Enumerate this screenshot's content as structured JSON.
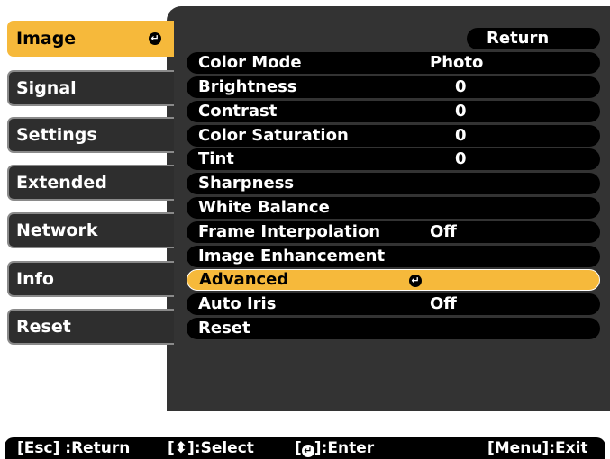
{
  "tabs": [
    {
      "label": "Image",
      "active": true
    },
    {
      "label": "Signal"
    },
    {
      "label": "Settings"
    },
    {
      "label": "Extended"
    },
    {
      "label": "Network"
    },
    {
      "label": "Info"
    },
    {
      "label": "Reset"
    }
  ],
  "return_label": "Return",
  "menu": [
    {
      "label": "Color Mode",
      "value": "Photo"
    },
    {
      "label": "Brightness",
      "value": "0"
    },
    {
      "label": "Contrast",
      "value": "0"
    },
    {
      "label": "Color Saturation",
      "value": "0"
    },
    {
      "label": "Tint",
      "value": "0"
    },
    {
      "label": "Sharpness",
      "value": ""
    },
    {
      "label": "White Balance",
      "value": ""
    },
    {
      "label": "Frame Interpolation",
      "value": "Off"
    },
    {
      "label": "Image Enhancement",
      "value": ""
    },
    {
      "label": "Advanced",
      "value": "",
      "selected": true
    },
    {
      "label": "Auto Iris",
      "value": "Off"
    },
    {
      "label": "Reset",
      "value": ""
    }
  ],
  "footer": {
    "esc": "[Esc] :Return",
    "select": "[⬍]:Select",
    "enter_prefix": "[",
    "enter_suffix": "]:Enter",
    "menu": "[Menu]:Exit"
  },
  "colors": {
    "accent": "#f6b93b",
    "panel": "#333333",
    "row": "#000000"
  }
}
